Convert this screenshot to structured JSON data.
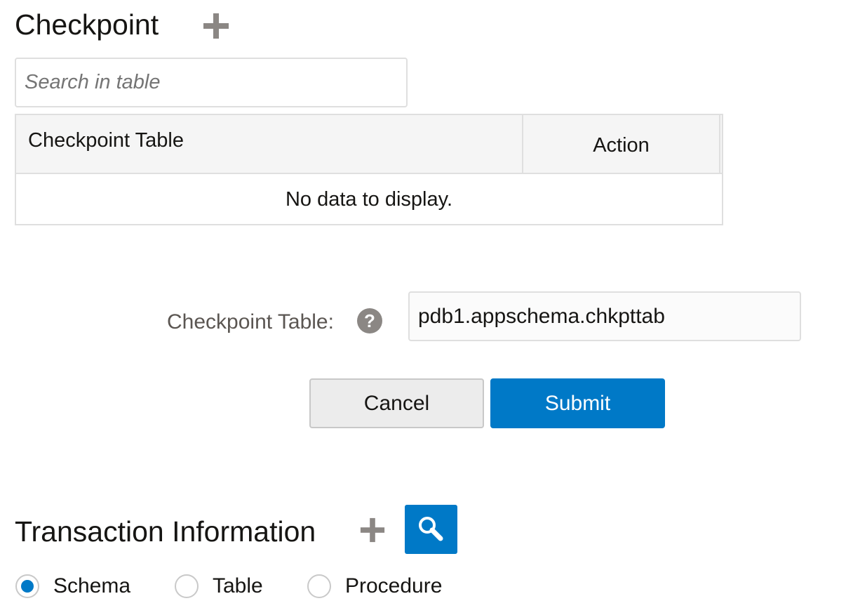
{
  "checkpoint": {
    "title": "Checkpoint",
    "add_icon": "plus-icon",
    "search": {
      "placeholder": "Search in table",
      "value": ""
    },
    "table": {
      "columns": [
        "Checkpoint Table",
        "Action"
      ],
      "empty_message": "No data to display."
    }
  },
  "form": {
    "label": "Checkpoint Table:",
    "help_icon": "help-icon",
    "help_glyph": "?",
    "value": "pdb1.appschema.chkpttab",
    "cancel_label": "Cancel",
    "submit_label": "Submit"
  },
  "transaction": {
    "title": "Transaction Information",
    "add_icon": "plus-icon",
    "search_icon": "magnifier-icon",
    "radios": [
      {
        "label": "Schema",
        "checked": true
      },
      {
        "label": "Table",
        "checked": false
      },
      {
        "label": "Procedure",
        "checked": false
      }
    ]
  },
  "colors": {
    "accent": "#0079c7",
    "icon_gray": "#8b8784",
    "border": "#dfdfdf"
  }
}
